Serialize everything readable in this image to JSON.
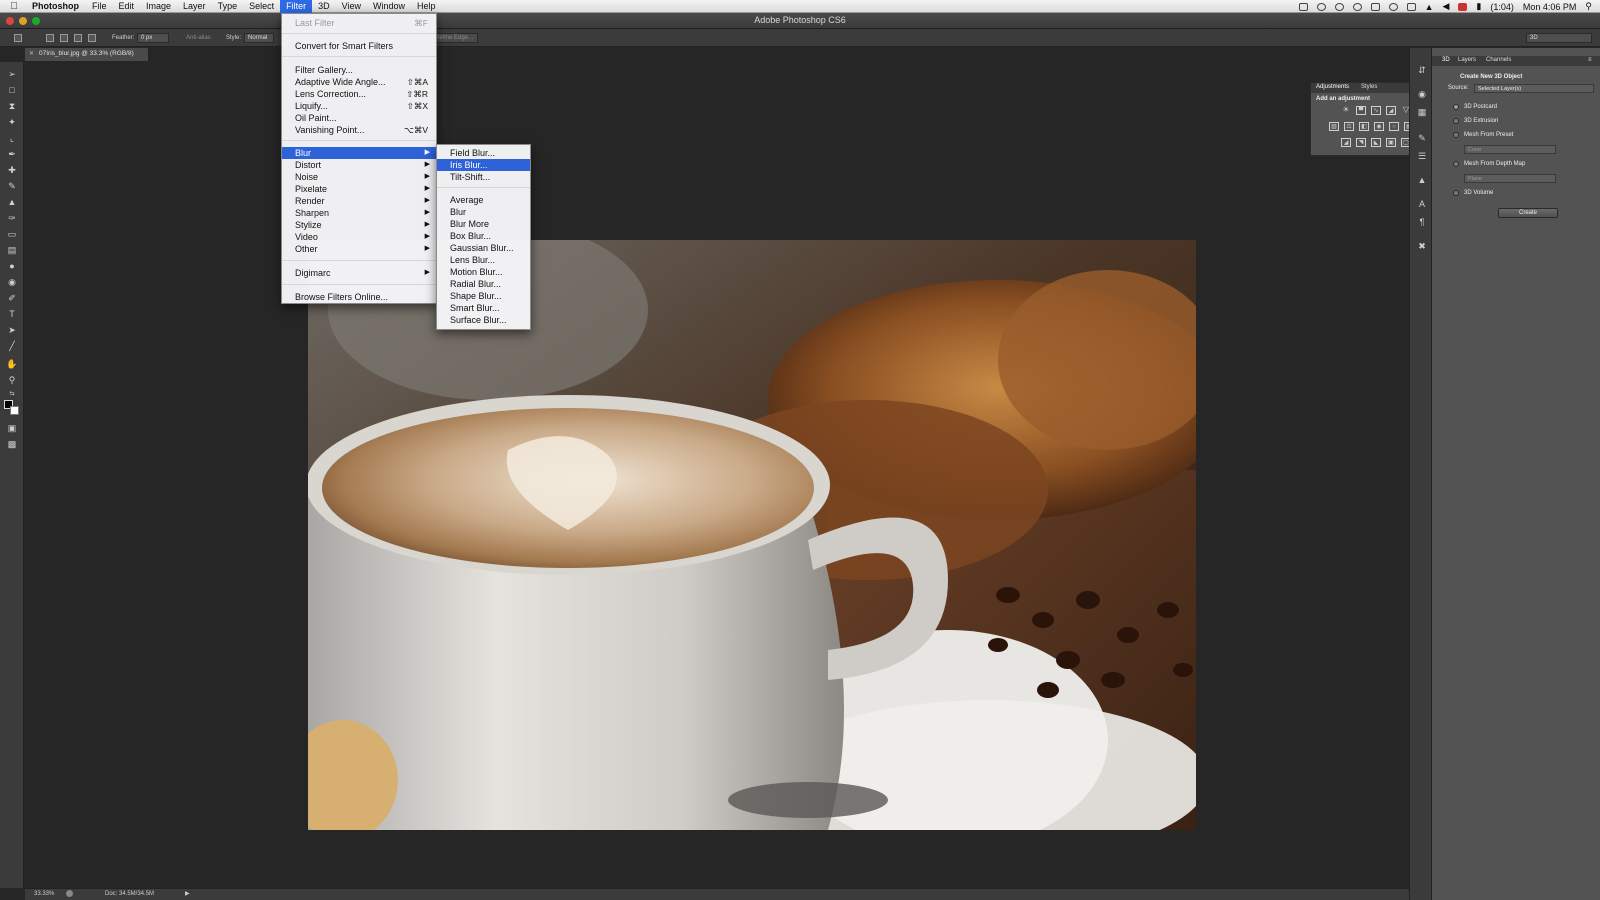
{
  "menubar": {
    "app": "Photoshop",
    "items": [
      "File",
      "Edit",
      "Image",
      "Layer",
      "Type",
      "Select",
      "Filter",
      "3D",
      "View",
      "Window",
      "Help"
    ],
    "battery": "(1:04)",
    "clock": "Mon 4:06 PM"
  },
  "window": {
    "title": "Adobe Photoshop CS6"
  },
  "options": {
    "feather_label": "Feather:",
    "feather_value": "0 px",
    "antialias_label": "Anti-alias",
    "style_label": "Style:",
    "style_value": "Normal",
    "refine_edge": "Refine Edge...",
    "workspace": "3D"
  },
  "document": {
    "tab_title": "07Iris_blur.jpg @ 33.3% (RGB/8)"
  },
  "status": {
    "zoom": "33.33%",
    "doc_size": "Doc: 34.5M/34.5M"
  },
  "filter_menu": {
    "last_filter": "Last Filter",
    "last_filter_shortcut": "⌘F",
    "convert_smart": "Convert for Smart Filters",
    "filter_gallery": "Filter Gallery...",
    "adaptive": "Adaptive Wide Angle...",
    "adaptive_shortcut": "⇧⌘A",
    "lens_correction": "Lens Correction...",
    "lens_correction_shortcut": "⇧⌘R",
    "liquify": "Liquify...",
    "liquify_shortcut": "⇧⌘X",
    "oil_paint": "Oil Paint...",
    "vanishing_point": "Vanishing Point...",
    "vanishing_point_shortcut": "⌥⌘V",
    "blur": "Blur",
    "distort": "Distort",
    "noise": "Noise",
    "pixelate": "Pixelate",
    "render": "Render",
    "sharpen": "Sharpen",
    "stylize": "Stylize",
    "video": "Video",
    "other": "Other",
    "digimarc": "Digimarc",
    "browse_online": "Browse Filters Online..."
  },
  "blur_menu": {
    "field_blur": "Field Blur...",
    "iris_blur": "Iris Blur...",
    "tilt_shift": "Tilt-Shift...",
    "average": "Average",
    "blur": "Blur",
    "blur_more": "Blur More",
    "box_blur": "Box Blur...",
    "gaussian_blur": "Gaussian Blur...",
    "lens_blur": "Lens Blur...",
    "motion_blur": "Motion Blur...",
    "radial_blur": "Radial Blur...",
    "shape_blur": "Shape Blur...",
    "smart_blur": "Smart Blur...",
    "surface_blur": "Surface Blur..."
  },
  "adjustments_panel": {
    "tab_adjustments": "Adjustments",
    "tab_styles": "Styles",
    "subtitle": "Add an adjustment"
  },
  "panel_3d": {
    "tab_3d": "3D",
    "tab_layers": "Layers",
    "tab_channels": "Channels",
    "heading": "Create New 3D Object",
    "source_label": "Source:",
    "source_value": "Selected Layer(s)",
    "opt_postcard": "3D Postcard",
    "opt_extrusion": "3D Extrusion",
    "opt_mesh_preset": "Mesh From Preset",
    "preset_value": "Cone",
    "opt_mesh_depth": "Mesh From Depth Map",
    "depth_value": "Plane",
    "opt_volume": "3D Volume",
    "create_button": "Create"
  }
}
